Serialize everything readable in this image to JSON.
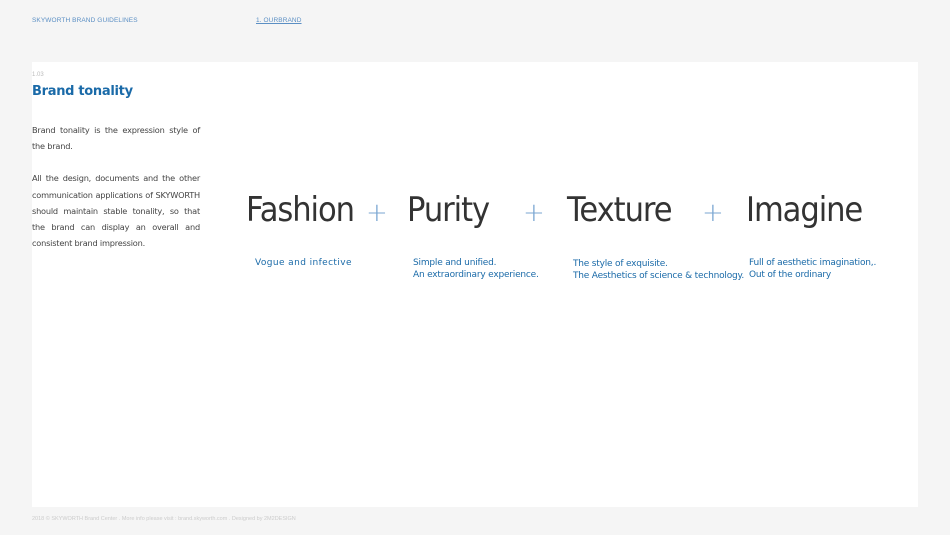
{
  "header": {
    "title": "SKYWORTH BRAND GUIDELINES",
    "section": "1. OURBRAND"
  },
  "page": {
    "number": "1.03",
    "title": "Brand tonality",
    "paragraphs": [
      "Brand tonality is the expression style of the brand.",
      "All the design, documents and the other communication applications of SKYWORTH should maintain stable tonality, so that the brand can display an overall and consistent brand impression."
    ]
  },
  "tonality": [
    {
      "word": "Fashion",
      "lines": [
        "Vogue and infective"
      ]
    },
    {
      "word": "Purity",
      "lines": [
        "Simple and unified.",
        "An extraordinary experience."
      ]
    },
    {
      "word": "Texture",
      "lines": [
        "The style of exquisite.",
        "The Aesthetics of science & technology."
      ]
    },
    {
      "word": "Imagine",
      "lines": [
        "Full of aesthetic imagination,.",
        "Out of the ordinary"
      ]
    }
  ],
  "separator": "+",
  "footer": "2018 © SKYWORTH Brand Center . More info please visit : brand.skyworth.com . Designed by 2M2DESIGN",
  "colors": {
    "accent": "#1a6aa8",
    "background": "#f5f5f5",
    "panel": "#ffffff"
  }
}
